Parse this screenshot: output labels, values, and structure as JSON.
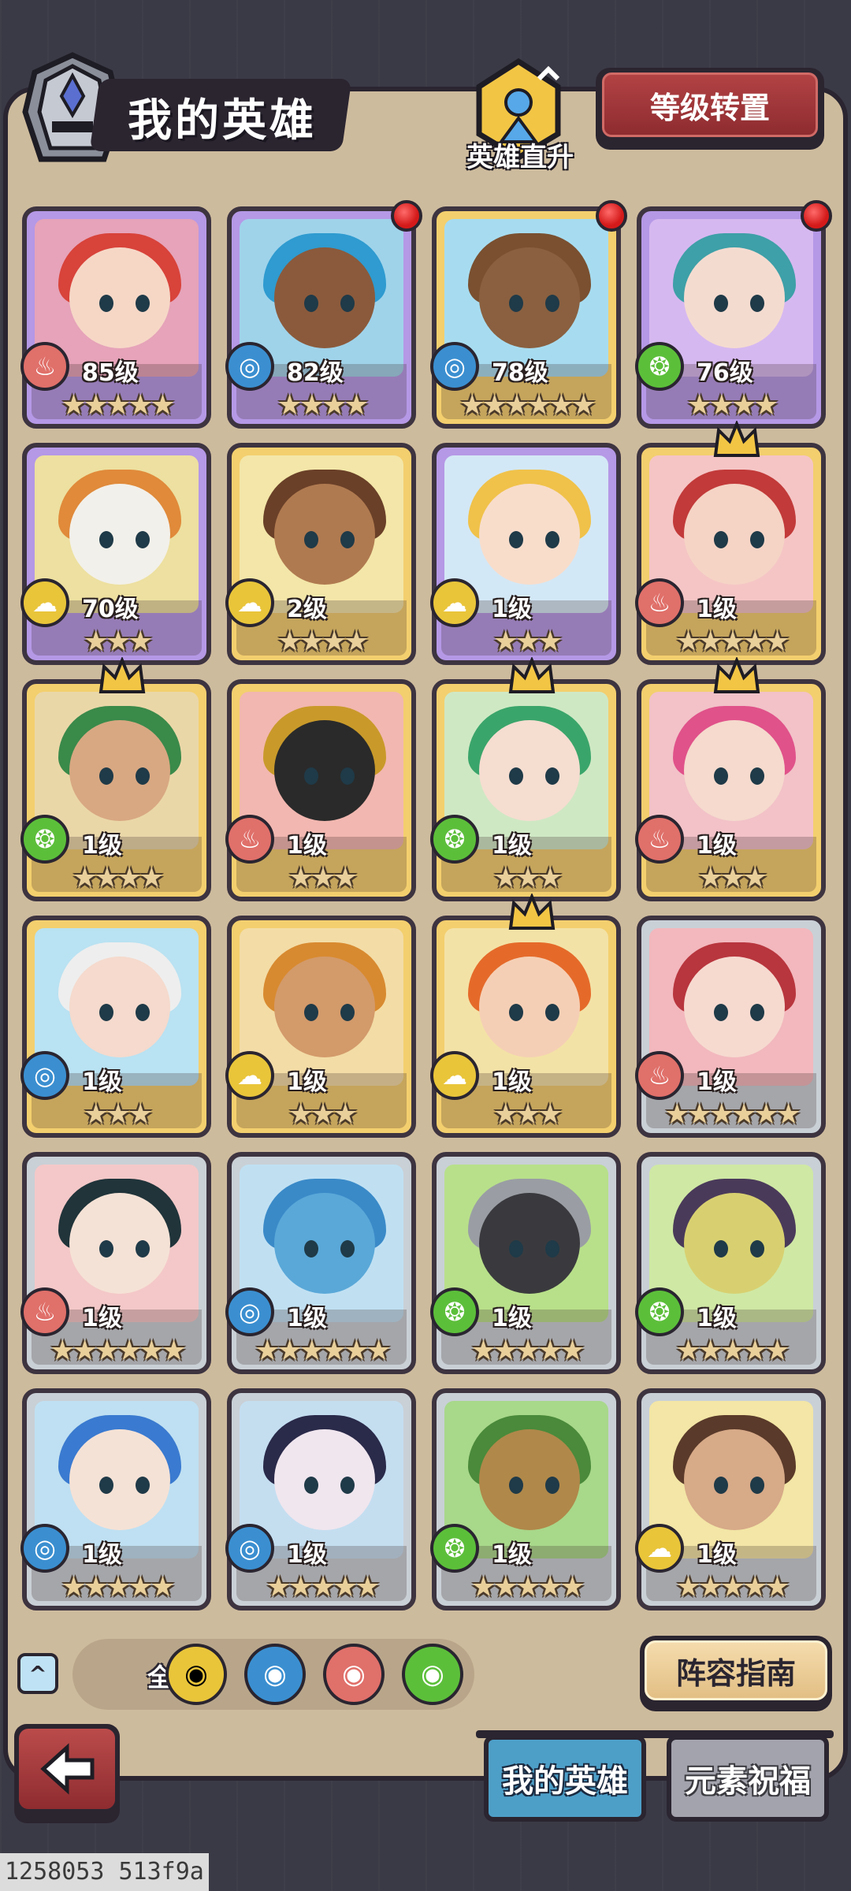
{
  "header": {
    "title": "我的英雄",
    "ascend_label": "英雄直升",
    "level_transfer_label": "等级转置"
  },
  "colors": {
    "fire": "#e0706a",
    "water": "#3b8fd0",
    "nature": "#5cbf3a",
    "earth": "#e9c53a",
    "card_purple": "#b598e6",
    "card_gold": "#f3cf6e",
    "card_silver": "#c9d0d6"
  },
  "heroes": [
    {
      "level": "85级",
      "element": "fire-icon",
      "stars": "★★★★★",
      "rarity": "purple",
      "art": "#e6a3b9",
      "hair": "#d8433a",
      "skin": "#f6d7c6",
      "red_dot": false,
      "crown": false
    },
    {
      "level": "82级",
      "element": "water-icon",
      "stars": "★★★★",
      "rarity": "purple",
      "art": "#9fd3ea",
      "hair": "#2f9bd0",
      "skin": "#8b5a3c",
      "red_dot": true,
      "crown": false
    },
    {
      "level": "78级",
      "element": "water-icon",
      "stars": "★★★★★★",
      "rarity": "gold",
      "art": "#a7dcf0",
      "hair": "#7a5030",
      "skin": "#8a6040",
      "red_dot": true,
      "crown": false
    },
    {
      "level": "76级",
      "element": "nature-icon",
      "stars": "★★★★",
      "rarity": "purple",
      "art": "#d6b8f0",
      "hair": "#3ea0a8",
      "skin": "#f4dbd0",
      "red_dot": true,
      "crown": false
    },
    {
      "level": "70级",
      "element": "earth-icon",
      "stars": "★★★",
      "rarity": "purple",
      "art": "#ede0a0",
      "hair": "#e08a3a",
      "skin": "#f2f0ea",
      "red_dot": false,
      "crown": false
    },
    {
      "level": "2级",
      "element": "earth-icon",
      "stars": "★★★★",
      "rarity": "gold",
      "art": "#f3e6a8",
      "hair": "#6a4028",
      "skin": "#b07a50",
      "red_dot": false,
      "crown": false
    },
    {
      "level": "1级",
      "element": "earth-icon",
      "stars": "★★★",
      "rarity": "purple",
      "art": "#d3e8f6",
      "hair": "#f0c24a",
      "skin": "#f8ddcb",
      "red_dot": false,
      "crown": false
    },
    {
      "level": "1级",
      "element": "fire-icon",
      "stars": "★★★★★",
      "rarity": "gold",
      "art": "#f5c5c5",
      "hair": "#c23a3a",
      "skin": "#f5d4c5",
      "red_dot": false,
      "crown": true
    },
    {
      "level": "1级",
      "element": "nature-icon",
      "stars": "★★★★",
      "rarity": "gold",
      "art": "#ead7a8",
      "hair": "#3a8a4a",
      "skin": "#d8a882",
      "red_dot": false,
      "crown": true
    },
    {
      "level": "1级",
      "element": "fire-icon",
      "stars": "★★★",
      "rarity": "gold",
      "art": "#f2b7b0",
      "hair": "#c99a2a",
      "skin": "#2a2a2a",
      "red_dot": false,
      "crown": false
    },
    {
      "level": "1级",
      "element": "nature-icon",
      "stars": "★★★",
      "rarity": "gold",
      "art": "#cfe8c4",
      "hair": "#3aa56a",
      "skin": "#f5ddd0",
      "red_dot": false,
      "crown": true
    },
    {
      "level": "1级",
      "element": "fire-icon",
      "stars": "★★★",
      "rarity": "gold",
      "art": "#f2c2c8",
      "hair": "#e0528a",
      "skin": "#f5dacd",
      "red_dot": false,
      "crown": true
    },
    {
      "level": "1级",
      "element": "water-icon",
      "stars": "★★★",
      "rarity": "gold",
      "art": "#b9e2f2",
      "hair": "#eeeeee",
      "skin": "#f5dacd",
      "red_dot": false,
      "crown": false
    },
    {
      "level": "1级",
      "element": "earth-icon",
      "stars": "★★★",
      "rarity": "gold",
      "art": "#f3dca6",
      "hair": "#d88a30",
      "skin": "#d39a6a",
      "red_dot": false,
      "crown": false
    },
    {
      "level": "1级",
      "element": "earth-icon",
      "stars": "★★★",
      "rarity": "gold",
      "art": "#f3e2a6",
      "hair": "#e56a2a",
      "skin": "#f5cfb5",
      "red_dot": false,
      "crown": true
    },
    {
      "level": "1级",
      "element": "fire-icon",
      "stars": "★★★★★★",
      "rarity": "silver",
      "art": "#f2b8bd",
      "hair": "#b8363e",
      "skin": "#f6dad0",
      "red_dot": false,
      "crown": false
    },
    {
      "level": "1级",
      "element": "fire-icon",
      "stars": "★★★★★★",
      "rarity": "silver",
      "art": "#f4c8c8",
      "hair": "#20343a",
      "skin": "#f5e2d6",
      "red_dot": false,
      "crown": false
    },
    {
      "level": "1级",
      "element": "water-icon",
      "stars": "★★★★★★",
      "rarity": "silver",
      "art": "#c0e0f2",
      "hair": "#3a8ac8",
      "skin": "#5aa8d8",
      "red_dot": false,
      "crown": false
    },
    {
      "level": "1级",
      "element": "nature-icon",
      "stars": "★★★★★",
      "rarity": "silver",
      "art": "#b8e08a",
      "hair": "#9a9ea4",
      "skin": "#3a3a3e",
      "red_dot": false,
      "crown": false
    },
    {
      "level": "1级",
      "element": "nature-icon",
      "stars": "★★★★★",
      "rarity": "silver",
      "art": "#cfe8a4",
      "hair": "#4a3a5a",
      "skin": "#d8d070",
      "red_dot": false,
      "crown": false
    },
    {
      "level": "1级",
      "element": "water-icon",
      "stars": "★★★★★",
      "rarity": "silver",
      "art": "#bfe0f2",
      "hair": "#3a7ad0",
      "skin": "#f5e2d6",
      "red_dot": false,
      "crown": false
    },
    {
      "level": "1级",
      "element": "water-icon",
      "stars": "★★★★★",
      "rarity": "silver",
      "art": "#c4def0",
      "hair": "#2a2a4a",
      "skin": "#f0e6ee",
      "red_dot": false,
      "crown": false
    },
    {
      "level": "1级",
      "element": "nature-icon",
      "stars": "★★★★★",
      "rarity": "silver",
      "art": "#a8d88a",
      "hair": "#4a8a3a",
      "skin": "#b0884a",
      "red_dot": false,
      "crown": false
    },
    {
      "level": "1级",
      "element": "earth-icon",
      "stars": "★★★★★",
      "rarity": "silver",
      "art": "#f3e6a6",
      "hair": "#5a3a2a",
      "skin": "#d7aa88",
      "red_dot": false,
      "crown": false
    }
  ],
  "filters": {
    "collapse_symbol": "^",
    "all_label": "全部",
    "all_selected": true,
    "elements": [
      "earth-icon",
      "water-icon",
      "fire-icon",
      "nature-icon"
    ]
  },
  "guide_label": "阵容指南",
  "tabs": [
    {
      "label": "我的英雄",
      "active": true
    },
    {
      "label": "元素祝福",
      "active": false
    }
  ],
  "build_id": "1258053 513f9a"
}
